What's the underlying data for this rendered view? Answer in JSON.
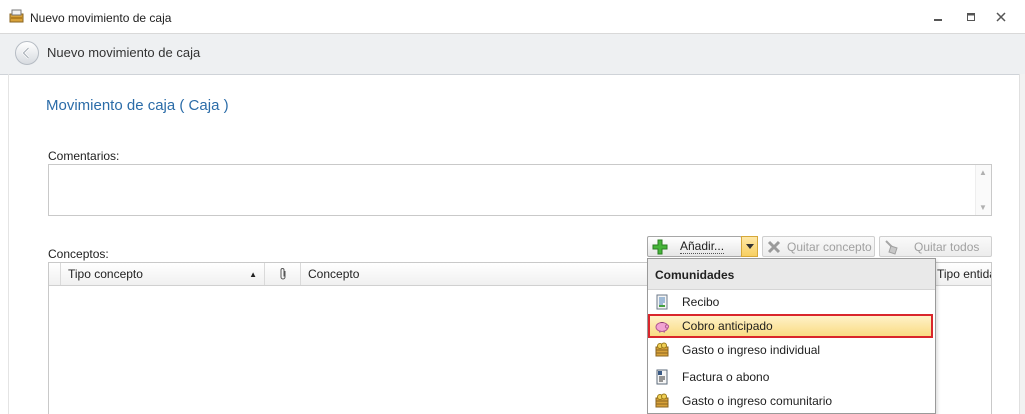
{
  "window": {
    "title": "Nuevo movimiento de caja",
    "controls": {
      "minimize": "—",
      "maximize": "▢",
      "close": "✕"
    }
  },
  "header": {
    "title": "Nuevo movimiento de caja"
  },
  "main": {
    "section_title": "Movimiento de caja ( Caja )",
    "comments_label": "Comentarios:",
    "comments_value": "",
    "concepts_label": "Conceptos:"
  },
  "toolbar": {
    "add_label": "Añadir...",
    "remove_label": "Quitar concepto",
    "remove_all_label": "Quitar todos"
  },
  "grid": {
    "columns": {
      "tipo_concepto": "Tipo concepto",
      "concepto": "Concepto",
      "tipo_entidad": "Tipo entidad"
    },
    "sort_indicator": "▲"
  },
  "menu": {
    "group": "Comunidades",
    "items": [
      {
        "label": "Recibo",
        "icon": "receipt-icon"
      },
      {
        "label": "Cobro anticipado",
        "icon": "piggy-bank-icon",
        "selected": true
      },
      {
        "label": "Gasto o ingreso individual",
        "icon": "coins-icon"
      },
      {
        "label": "Factura o abono",
        "icon": "invoice-icon"
      },
      {
        "label": "Gasto o ingreso comunitario",
        "icon": "coins-icon"
      }
    ]
  },
  "colors": {
    "accent": "#2b6ca8",
    "selection_outline": "#d9262c",
    "selection_fill": "#f9d97c"
  }
}
